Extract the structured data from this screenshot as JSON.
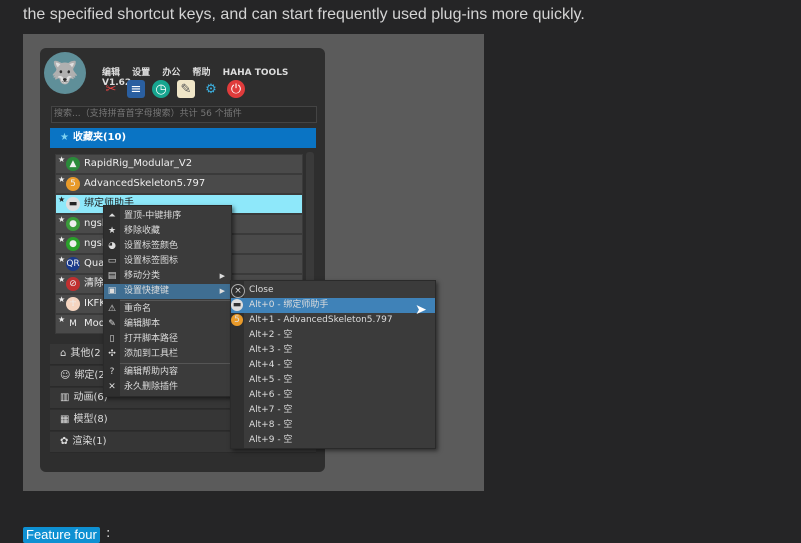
{
  "intro_text": "the specified shortcut keys, and can start frequently used plug-ins more quickly.",
  "app": {
    "title": "HAHA TOOLS V1.62",
    "menu": [
      "编辑",
      "设置",
      "办公",
      "帮助"
    ],
    "toolbar_icons": [
      "tools-icon",
      "book-icon",
      "history-icon",
      "notepad-icon",
      "gear-icon",
      "power-icon"
    ],
    "search_placeholder": "搜索...（支持拼音首字母搜索）共计 56 个插件",
    "favorites_label": "收藏夹(10)",
    "items": [
      {
        "name": "RapidRig_Modular_V2",
        "badge": ""
      },
      {
        "name": "AdvancedSkeleton5.797",
        "badge": "1"
      },
      {
        "name": "绑定师助手",
        "badge": "0"
      },
      {
        "name": "ngsk",
        "badge": ""
      },
      {
        "name": "ngsk",
        "badge": ""
      },
      {
        "name": "Qua",
        "badge": ""
      },
      {
        "name": "清除",
        "badge": ""
      },
      {
        "name": "IKFK",
        "badge": ""
      },
      {
        "name": "Mod",
        "badge": ""
      }
    ],
    "categories": [
      "其他(2",
      "绑定(2",
      "动画(6)",
      "模型(8)",
      "渲染(1)"
    ],
    "context_menu": [
      "置顶-中键排序",
      "移除收藏",
      "设置标签颜色",
      "设置标签图标",
      "移动分类",
      "设置快捷键",
      "重命名",
      "编辑脚本",
      "打开脚本路径",
      "添加到工具栏",
      "编辑帮助内容",
      "永久删除插件"
    ],
    "shortcut_menu": [
      "Close",
      "Alt+0 - 绑定师助手",
      "Alt+1 - AdvancedSkeleton5.797",
      "Alt+2 - 空",
      "Alt+3 - 空",
      "Alt+4 - 空",
      "Alt+5 - 空",
      "Alt+6 - 空",
      "Alt+7 - 空",
      "Alt+8 - 空",
      "Alt+9 - 空"
    ]
  },
  "feature_badge": "Feature four",
  "colon": ":",
  "colors": {
    "accent": "#0a74c4",
    "selected": "#8ee8fa",
    "badge": "#0e90d2"
  }
}
